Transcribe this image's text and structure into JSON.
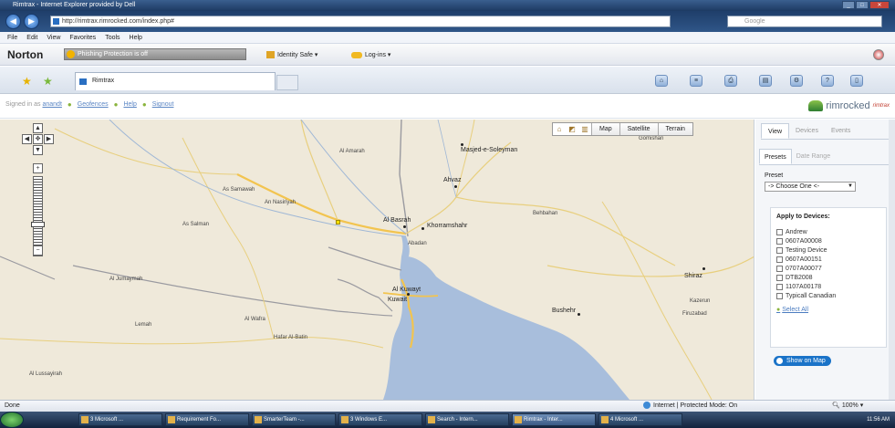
{
  "window": {
    "title": "Rimtrax - Internet Explorer provided by Dell",
    "url": "http://rimtrax.rimrocked.com/index.php#",
    "search_placeholder": "Google"
  },
  "menu": [
    "File",
    "Edit",
    "View",
    "Favorites",
    "Tools",
    "Help"
  ],
  "norton": {
    "logo": "Norton",
    "phishing": "Phishing Protection is off",
    "identity": "Identity Safe ▾",
    "logins": "Log-ins ▾"
  },
  "tab": {
    "title": "Rimtrax"
  },
  "header": {
    "signed_prefix": "Signed in as",
    "user": "anandt",
    "links": [
      "Geofences",
      "Help",
      "Signout"
    ],
    "brand": "rimrocked",
    "brand_sub": "rimtrax"
  },
  "map": {
    "buttons": [
      "Map",
      "Satellite",
      "Terrain"
    ],
    "labels": [
      {
        "text": "Masjed-e-Soleyman",
        "big": true
      },
      {
        "text": "Gomishan",
        "big": false
      },
      {
        "text": "Ahvaz",
        "big": true
      },
      {
        "text": "Al Basrah",
        "big": true
      },
      {
        "text": "Khorramshahr",
        "big": true
      },
      {
        "text": "Abadan",
        "big": false
      },
      {
        "text": "Al Kuwayt",
        "big": true
      },
      {
        "text": "Kuwait",
        "big": true
      },
      {
        "text": "Bushehr",
        "big": true
      },
      {
        "text": "Shiraz",
        "big": true
      },
      {
        "text": "Al Amarah",
        "big": false
      },
      {
        "text": "An Nasiriyah",
        "big": false
      },
      {
        "text": "As Samawah",
        "big": false
      },
      {
        "text": "As Salman",
        "big": false
      },
      {
        "text": "Behbahan",
        "big": false
      },
      {
        "text": "Kazerun",
        "big": false
      },
      {
        "text": "Firuzabad",
        "big": false
      },
      {
        "text": "Al Wafra",
        "big": false
      },
      {
        "text": "Hafar Al-Batin",
        "big": false
      },
      {
        "text": "Al Jumaymah",
        "big": false
      },
      {
        "text": "Lemah",
        "big": false
      },
      {
        "text": "Al Lussayirah",
        "big": false
      }
    ]
  },
  "panel": {
    "tabs": [
      "View",
      "Devices",
      "Events"
    ],
    "sub_tabs": [
      "Presets",
      "Date Range"
    ],
    "preset_label": "Preset",
    "preset_value": "-> Choose One <-",
    "apply_title": "Apply to Devices:",
    "devices": [
      "Andrew",
      "0607A00008",
      "Testing Device",
      "0607A00151",
      "0707A00077",
      "DTB2008",
      "1107A00178",
      "Typicall Canadian"
    ],
    "select_all": "Select All",
    "show_map": "Show on Map"
  },
  "status": {
    "left": "Done",
    "zone": "Internet | Protected Mode: On",
    "zoom": "100%"
  },
  "taskbar": {
    "items": [
      "3 Microsoft ...",
      "Requirement Fo...",
      "SmarterTeam -...",
      "3 Windows E...",
      "Search - Intern...",
      "Rimtrax - Inter...",
      "4 Microsoft ..."
    ],
    "active_index": 5,
    "clock": "11:56 AM"
  },
  "colors": {
    "water": "#a8bedc",
    "land": "#efe9da",
    "road_major": "#f2c44f",
    "road_minor": "#e8dcae",
    "border": "#9a9aa0"
  }
}
